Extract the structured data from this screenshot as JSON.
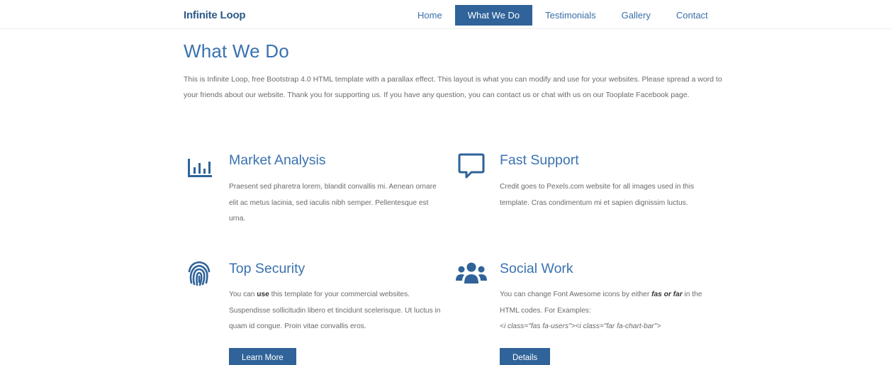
{
  "brand": "Infinite Loop",
  "nav": [
    {
      "label": "Home",
      "active": false
    },
    {
      "label": "What We Do",
      "active": true
    },
    {
      "label": "Testimonials",
      "active": false
    },
    {
      "label": "Gallery",
      "active": false
    },
    {
      "label": "Contact",
      "active": false
    }
  ],
  "section": {
    "title": "What We Do",
    "intro": "This is Infinite Loop, free Bootstrap 4.0 HTML template with a parallax effect. This layout is what you can modify and use for your websites. Please spread a word to your friends about our website. Thank you for supporting us. If you have any question, you can contact us or chat with us on our Tooplate Facebook page."
  },
  "features": {
    "market": {
      "icon": "chart-bar-icon",
      "title": "Market Analysis",
      "text": "Praesent sed pharetra lorem, blandit convallis mi. Aenean ornare elit ac metus lacinia, sed iaculis nibh semper. Pellentesque est urna."
    },
    "support": {
      "icon": "comment-icon",
      "title": "Fast Support",
      "text": "Credit goes to Pexels.com website for all images used in this template. Cras condimentum mi et sapien dignissim luctus."
    },
    "security": {
      "icon": "fingerprint-icon",
      "title": "Top Security",
      "text_before": "You can ",
      "text_bold": "use",
      "text_after": " this template for your commercial websites. Suspendisse sollicitudin libero et tincidunt scelerisque. Ut luctus in quam id congue. Proin vitae convallis eros.",
      "button": "Learn More"
    },
    "social": {
      "icon": "users-icon",
      "title": "Social Work",
      "text_before": "You can change Font Awesome icons by either ",
      "text_em": "fas or far",
      "text_after": " in the HTML codes. For Examples:",
      "code": "<i class=\"fas fa-users\"><i class=\"far fa-chart-bar\">",
      "button": "Details"
    }
  },
  "colors": {
    "accent": "#2f6399",
    "heading": "#3a72b0",
    "brand": "#2d5a8a",
    "text": "#6a6a6a"
  }
}
